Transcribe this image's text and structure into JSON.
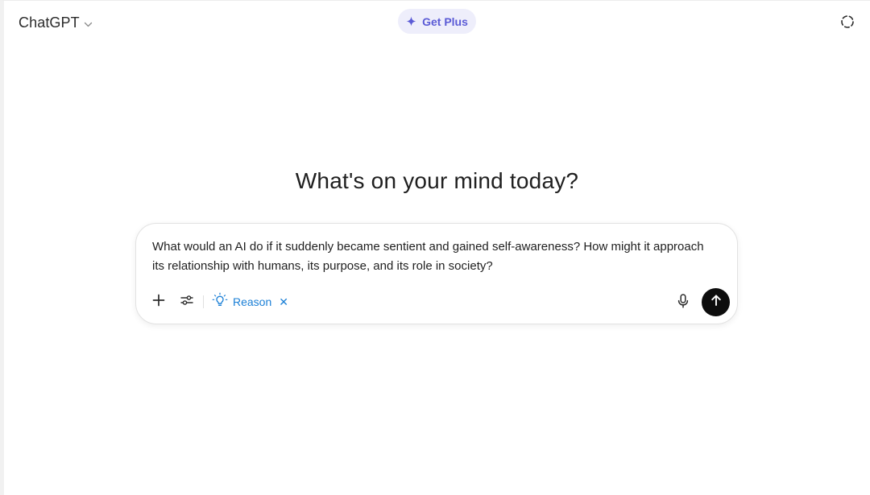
{
  "header": {
    "model_name": "ChatGPT",
    "model_switcher_icon": "chevron-down-icon",
    "upgrade_label": "Get Plus",
    "upgrade_icon": "sparkle-icon",
    "temporary_chat_icon": "dashed-circle-icon"
  },
  "main": {
    "headline": "What's on your mind today?"
  },
  "composer": {
    "prompt_text": "What would an AI do if it suddenly became sentient and gained self-awareness? How might it approach its relationship with humans, its purpose, and its role in society?",
    "attach_icon": "plus-icon",
    "tools_icon": "sliders-icon",
    "reason_label": "Reason",
    "reason_icon": "lightbulb-icon",
    "reason_remove": "✕",
    "mic_icon": "microphone-icon",
    "send_icon": "arrow-up-icon"
  },
  "colors": {
    "accent": "#5b5bd6",
    "accent_bg": "#eeeefb",
    "reason_blue": "#1a7fd6",
    "send_bg": "#0d0d0d"
  }
}
